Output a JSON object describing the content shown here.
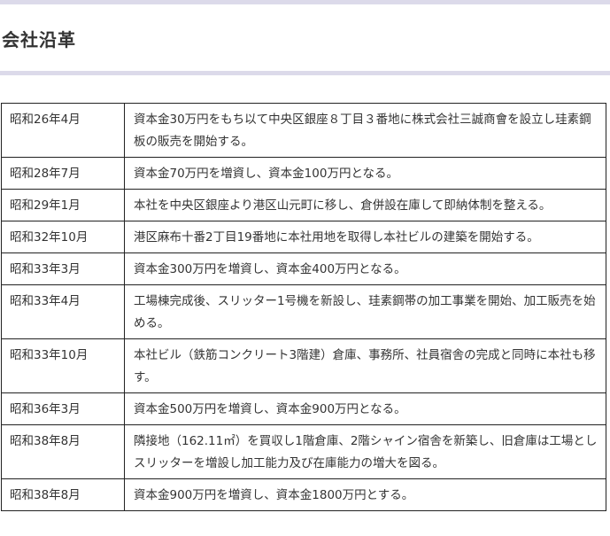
{
  "section": {
    "title": "会社沿革"
  },
  "history": [
    {
      "date": "昭和26年4月",
      "event": "資本金30万円をもち以て中央区銀座８丁目３番地に株式会社三誠商會を設立し珪素鋼板の販売を開始する。"
    },
    {
      "date": "昭和28年7月",
      "event": "資本金70万円を増資し、資本金100万円となる。"
    },
    {
      "date": "昭和29年1月",
      "event": "本社を中央区銀座より港区山元町に移し、倉併設在庫して即納体制を整える。"
    },
    {
      "date": "昭和32年10月",
      "event": "港区麻布十番2丁目19番地に本社用地を取得し本社ビルの建築を開始する。"
    },
    {
      "date": "昭和33年3月",
      "event": "資本金300万円を増資し、資本金400万円となる。"
    },
    {
      "date": "昭和33年4月",
      "event": "工場棟完成後、スリッター1号機を新設し、珪素鋼帯の加工事業を開始、加工販売を始める。"
    },
    {
      "date": "昭和33年10月",
      "event": "本社ビル（鉄筋コンクリート3階建）倉庫、事務所、社員宿舎の完成と同時に本社も移す。"
    },
    {
      "date": "昭和36年3月",
      "event": "資本金500万円を増資し、資本金900万円となる。"
    },
    {
      "date": "昭和38年8月",
      "event": "隣接地（162.11㎡）を買収し1階倉庫、2階シャイン宿舎を新築し、旧倉庫は工場としスリッターを増設し加工能力及び在庫能力の増大を図る。"
    },
    {
      "date": "昭和38年8月",
      "event": "資本金900万円を増資し、資本金1800万円とする。"
    }
  ]
}
